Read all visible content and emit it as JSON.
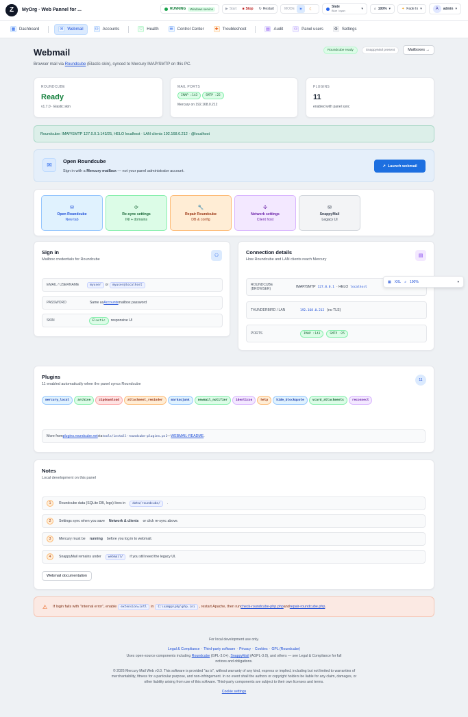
{
  "app": {
    "title": "MyOrg · Web Pannel for ...",
    "logo": "Z"
  },
  "topbar": {
    "status": "RUNNING",
    "service": "Windows service",
    "start": "Start",
    "stop": "Stop",
    "restart": "Restart",
    "mode_label": "MODE",
    "theme_name": "Slate",
    "theme_sub": "Blue / cyan",
    "zoom": "100%",
    "fade": "Fade In",
    "avatar": "A",
    "user": "admin"
  },
  "nav": {
    "items": [
      {
        "label": "Dashboard"
      },
      {
        "label": "Webmail"
      },
      {
        "label": "Accounts"
      },
      {
        "label": "Health"
      },
      {
        "label": "Control Center"
      },
      {
        "label": "Troubleshoot"
      },
      {
        "label": "Audit"
      },
      {
        "label": "Panel users"
      },
      {
        "label": "Settings"
      }
    ]
  },
  "page": {
    "title": "Webmail",
    "subtitle_pre": "Browser mail via ",
    "subtitle_link": "Roundcube",
    "subtitle_post": " (Elastic skin), synced to Mercury IMAP/SMTP on this PC.",
    "badge_ready": "Roundcube ready",
    "badge_snappy": "SnappyMail present",
    "mailboxes_btn": "Mailboxes →"
  },
  "stats": {
    "roundcube": {
      "label": "ROUNDCUBE",
      "value": "Ready",
      "note": "v1.7.0 · Elastic skin"
    },
    "ports": {
      "label": "MAIL PORTS",
      "imap": "IMAP :143",
      "smtp": "SMTP :25",
      "note": "Mercury on 192.168.0.212"
    },
    "plugins": {
      "label": "PLUGINS",
      "value": "11",
      "note": "enabled with panel sync"
    }
  },
  "banner": "Roundcube: IMAP/SMTP 127.0.0.1:143/25, HELO localhost · LAN clients 192.168.0.212 · @localhost",
  "launch": {
    "title": "Open Roundcube",
    "text_pre": "Sign in with a ",
    "text_bold": "Mercury mailbox",
    "text_post": " — not your panel administrator account.",
    "button": "Launch webmail"
  },
  "tiles": [
    {
      "icon": "✉",
      "title": "Open Roundcube",
      "sub": "New tab"
    },
    {
      "icon": "⟳",
      "title": "Re-sync settings",
      "sub": "INI + domains"
    },
    {
      "icon": "🔧",
      "title": "Repair Roundcube",
      "sub": "DB & config"
    },
    {
      "icon": "✣",
      "title": "Network settings",
      "sub": "Client host"
    },
    {
      "icon": "✉",
      "title": "SnappyMail",
      "sub": "Legacy UI"
    }
  ],
  "signin": {
    "title": "Sign in",
    "sub": "Mailbox credentials for Roundcube",
    "email_label": "EMAIL / USERNAME",
    "email_a": "myuser",
    "email_or": "or",
    "email_b": "myuser@localhost",
    "pw_label": "PASSWORD",
    "pw_pre": "Same as ",
    "pw_link": "Accounts",
    "pw_post": " mailbox password",
    "skin_label": "SKIN",
    "skin_tag": "Elastic",
    "skin_post": "responsive UI"
  },
  "conn": {
    "title": "Connection details",
    "sub": "How Roundcube and LAN clients reach Mercury",
    "rc_label": "ROUNDCUBE (BROWSER)",
    "rc_pre": "IMAP/SMTP",
    "rc_ip": "127.0.0.1",
    "rc_mid": "· HELO",
    "rc_host": "localhost",
    "tb_label": "THUNDERBIRD / LAN",
    "tb_ip": "192.168.0.212",
    "tb_post": "(no TLS)",
    "ports_label": "PORTS",
    "imap": "IMAP :143",
    "smtp": "SMTP :25"
  },
  "floating": {
    "a": "XXL",
    "b": "100%"
  },
  "plugins": {
    "title": "Plugins",
    "sub": "11 enabled automatically when the panel syncs Roundcube",
    "count": "11",
    "items": [
      {
        "name": "mercury_local",
        "c": "p-b"
      },
      {
        "name": "archive",
        "c": "p-g"
      },
      {
        "name": "zipdownload",
        "c": "p-r"
      },
      {
        "name": "attachment_reminder",
        "c": "p-o"
      },
      {
        "name": "markasjunk",
        "c": "p-b"
      },
      {
        "name": "newmail_notifier",
        "c": "p-g"
      },
      {
        "name": "identicon",
        "c": "p-p"
      },
      {
        "name": "help",
        "c": "p-o"
      },
      {
        "name": "hide_blockquote",
        "c": "p-b"
      },
      {
        "name": "vcard_attachments",
        "c": "p-g"
      },
      {
        "name": "reconnect",
        "c": "p-p"
      }
    ],
    "more_pre": "More from ",
    "more_link": "plugins.roundcube.net",
    "more_mid": " via ",
    "more_code": "tools/install-roundcube-plugins.ps1",
    "more_dash": " — ",
    "more_link2": "WEBMAIL-README",
    "more_end": "."
  },
  "notes": {
    "title": "Notes",
    "sub": "Local development on this panel",
    "items": [
      {
        "n": "1",
        "pre": "Roundcube data (SQLite DB, logs) lives in",
        "code": "data/roundcube/",
        "post": "."
      },
      {
        "n": "2",
        "pre": "Settings sync when you save",
        "bold": "Network & clients",
        "post": "or click re-sync above."
      },
      {
        "n": "3",
        "pre": "Mercury must be",
        "bold": "running",
        "post": "before you log in to webmail."
      },
      {
        "n": "4",
        "pre": "SnappyMail remains under",
        "code": "webmail/",
        "post": "if you still need the legacy UI."
      }
    ],
    "doc_btn": "Webmail documentation"
  },
  "warning": {
    "pre": "If login fails with \"internal error\", enable ",
    "code1": "extension=intl",
    "mid": " in ",
    "code2": "C:\\xampp\\php\\php.ini",
    "mid2": ", restart Apache, then run ",
    "link1": "check-roundcube-php.php",
    "and": " and ",
    "link2": "repair-roundcube.php",
    "end": "."
  },
  "footer": {
    "line1": "For local development use only.",
    "links": [
      "Legal & Compliance",
      "Third-party software",
      "Privacy",
      "Cookies",
      "GPL (Roundcube)"
    ],
    "oss_pre": "Uses open-source components including ",
    "oss_l1": "Roundcube",
    "oss_m1": " (GPL-3.0+), ",
    "oss_l2": "SnappyMail",
    "oss_post": " (AGPL-3.0), and others — see Legal & Compliance for full notices and obligations.",
    "copyright": "© 2026 Mercury Mail Web v3.0. This software is provided \"as is\", without warranty of any kind, express or implied, including but not limited to warranties of merchantability, fitness for a particular purpose, and non-infringement. In no event shall the authors or copyright holders be liable for any claim, damages, or other liability arising from use of this software. Third-party components are subject to their own licenses and terms.",
    "cookie": "Cookie settings"
  }
}
